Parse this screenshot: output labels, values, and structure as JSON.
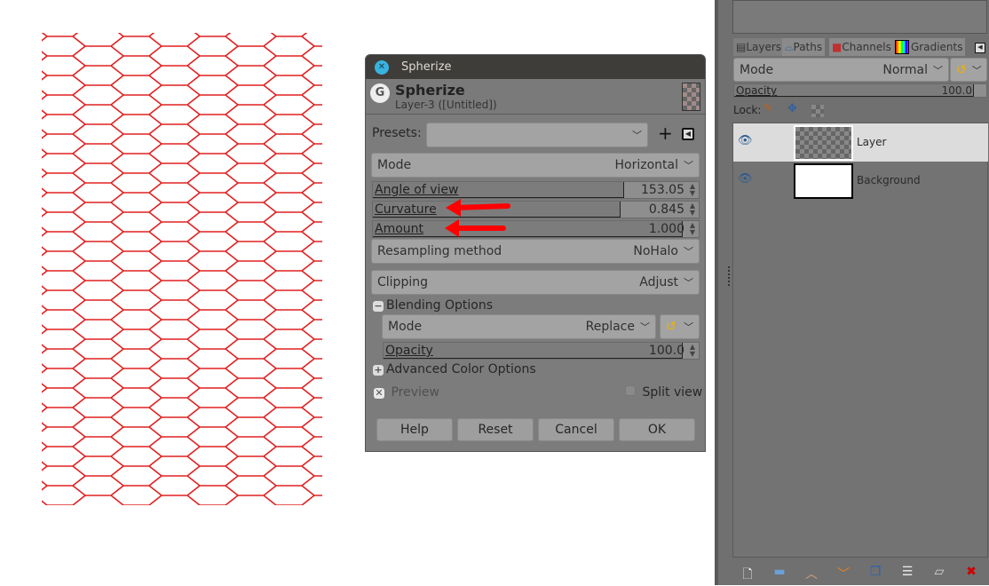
{
  "canvas": {
    "stroke_color": "#e02020"
  },
  "dialog": {
    "window_title": "Spherize",
    "header_title": "Spherize",
    "header_subtitle": "Layer-3 ([Untitled])",
    "presets_label": "Presets:",
    "presets_value": "",
    "mode_label": "Mode",
    "mode_value": "Horizontal",
    "angle_label": "Angle of view",
    "angle_value": "153.05",
    "angle_fraction": 0.77,
    "curvature_label": "Curvature",
    "curvature_value": "0.845",
    "curvature_fraction": 0.845,
    "amount_label": "Amount",
    "amount_value": "1.000",
    "amount_fraction": 1.0,
    "resampling_label": "Resampling method",
    "resampling_value": "NoHalo",
    "clipping_label": "Clipping",
    "clipping_value": "Adjust",
    "blending_label": "Blending Options",
    "blend_mode_label": "Mode",
    "blend_mode_value": "Replace",
    "opacity_label": "Opacity",
    "opacity_value": "100.0",
    "advanced_label": "Advanced Color Options",
    "preview_label": "Preview",
    "preview_checked": true,
    "split_label": "Split view",
    "split_checked": false,
    "buttons": {
      "help": "Help",
      "reset": "Reset",
      "cancel": "Cancel",
      "ok": "OK"
    }
  },
  "layers_panel": {
    "tabs": [
      "Layers",
      "Paths",
      "Channels",
      "Gradients"
    ],
    "mode_label": "Mode",
    "mode_value": "Normal",
    "opacity_label": "Opacity",
    "opacity_value": "100.0",
    "lock_label": "Lock:",
    "layers": [
      {
        "name": "Layer",
        "selected": true
      },
      {
        "name": "Background",
        "selected": false
      }
    ]
  }
}
